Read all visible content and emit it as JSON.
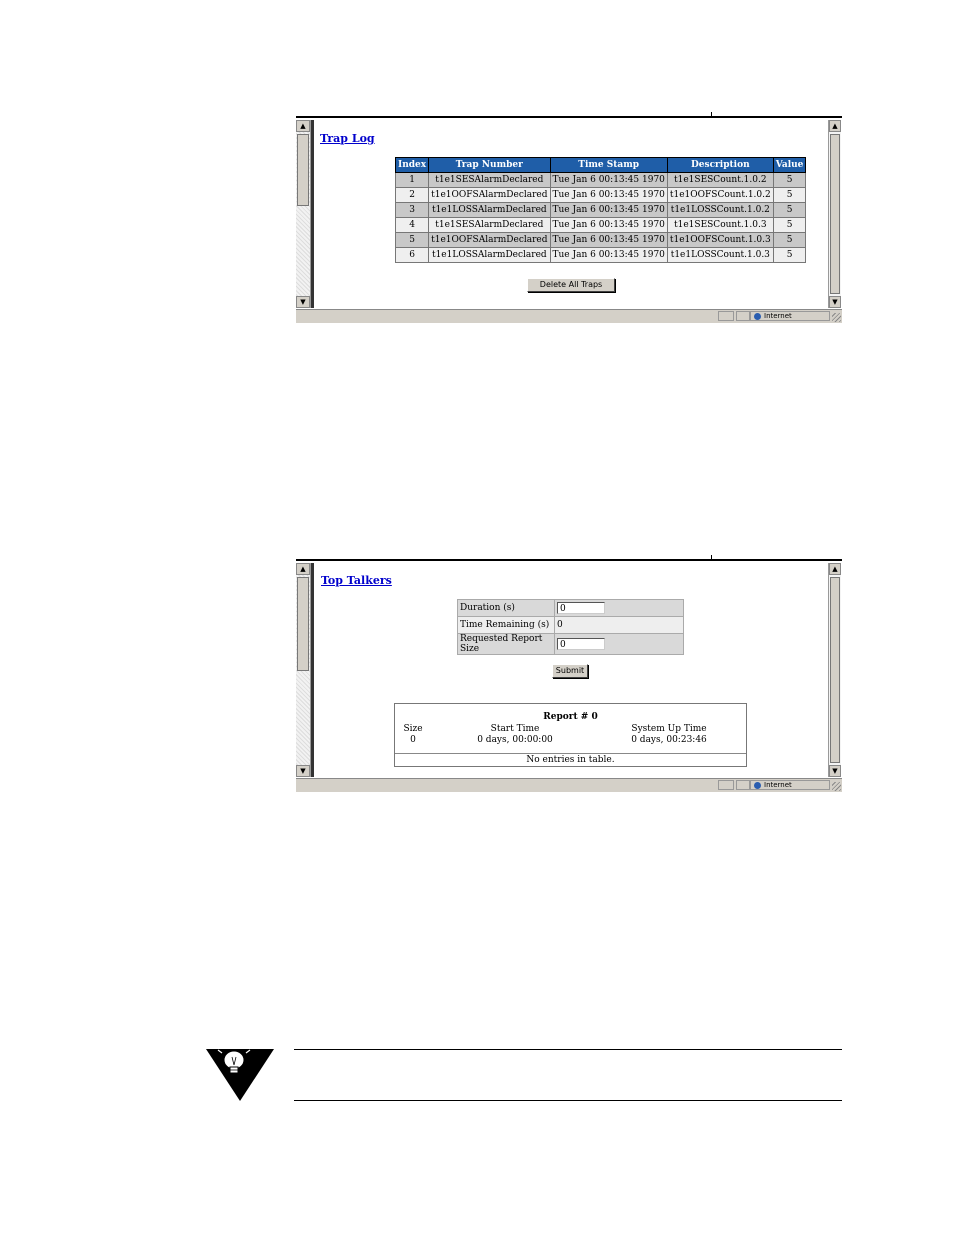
{
  "trap_log": {
    "title": "Trap Log",
    "columns": [
      "Index",
      "Trap Number",
      "Time Stamp",
      "Description",
      "Value"
    ],
    "rows": [
      [
        "1",
        "t1e1SESAlarmDeclared",
        "Tue Jan 6 00:13:45 1970",
        "t1e1SESCount.1.0.2",
        "5"
      ],
      [
        "2",
        "t1e1OOFSAlarmDeclared",
        "Tue Jan 6 00:13:45 1970",
        "t1e1OOFSCount.1.0.2",
        "5"
      ],
      [
        "3",
        "t1e1LOSSAlarmDeclared",
        "Tue Jan 6 00:13:45 1970",
        "t1e1LOSSCount.1.0.2",
        "5"
      ],
      [
        "4",
        "t1e1SESAlarmDeclared",
        "Tue Jan 6 00:13:45 1970",
        "t1e1SESCount.1.0.3",
        "5"
      ],
      [
        "5",
        "t1e1OOFSAlarmDeclared",
        "Tue Jan 6 00:13:45 1970",
        "t1e1OOFSCount.1.0.3",
        "5"
      ],
      [
        "6",
        "t1e1LOSSAlarmDeclared",
        "Tue Jan 6 00:13:45 1970",
        "t1e1LOSSCount.1.0.3",
        "5"
      ]
    ],
    "delete_button": "Delete All Traps",
    "status_zone": "Internet",
    "header_color": "#1f5ea8"
  },
  "top_talkers": {
    "title": "Top Talkers",
    "duration_label": "Duration (s)",
    "duration_value": "0",
    "remaining_label": "Time Remaining (s)",
    "remaining_value": "0",
    "report_size_label": "Requested Report Size",
    "report_size_value": "0",
    "submit_button": "Submit",
    "report_title": "Report # 0",
    "size_label": "Size",
    "size_value": "0",
    "start_label": "Start Time",
    "start_value": "0 days, 00:00:00",
    "uptime_label": "System Up Time",
    "uptime_value": "0 days, 00:23:46",
    "no_entries": "No entries in table.",
    "status_zone": "Internet"
  },
  "icons": {
    "scroll_up": "arrow-up-icon",
    "scroll_down": "arrow-down-icon",
    "zone": "globe-icon",
    "note": "lightbulb-note-icon"
  }
}
